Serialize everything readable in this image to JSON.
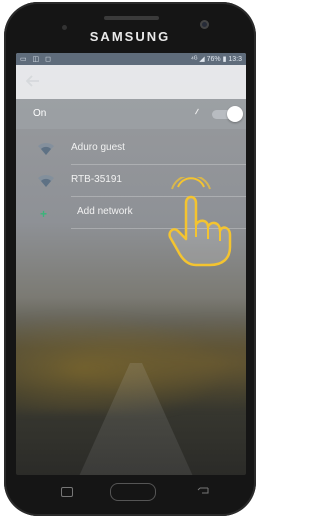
{
  "device": {
    "brand": "SAMSUNG"
  },
  "statusbar": {
    "right_text": "⁴ᴳ ◢ 76% ▮ 13:3"
  },
  "settings": {
    "master_toggle_label": "On",
    "master_toggle_state": "on"
  },
  "networks": [
    {
      "name": "Aduro guest",
      "signal_icon": "wifi-icon"
    },
    {
      "name": "RTB-35191",
      "signal_icon": "wifi-icon"
    }
  ],
  "add_network": {
    "label": "Add network",
    "icon": "plus-icon"
  },
  "colors": {
    "accent": "#f4c430",
    "add_icon": "#3ab57a"
  }
}
